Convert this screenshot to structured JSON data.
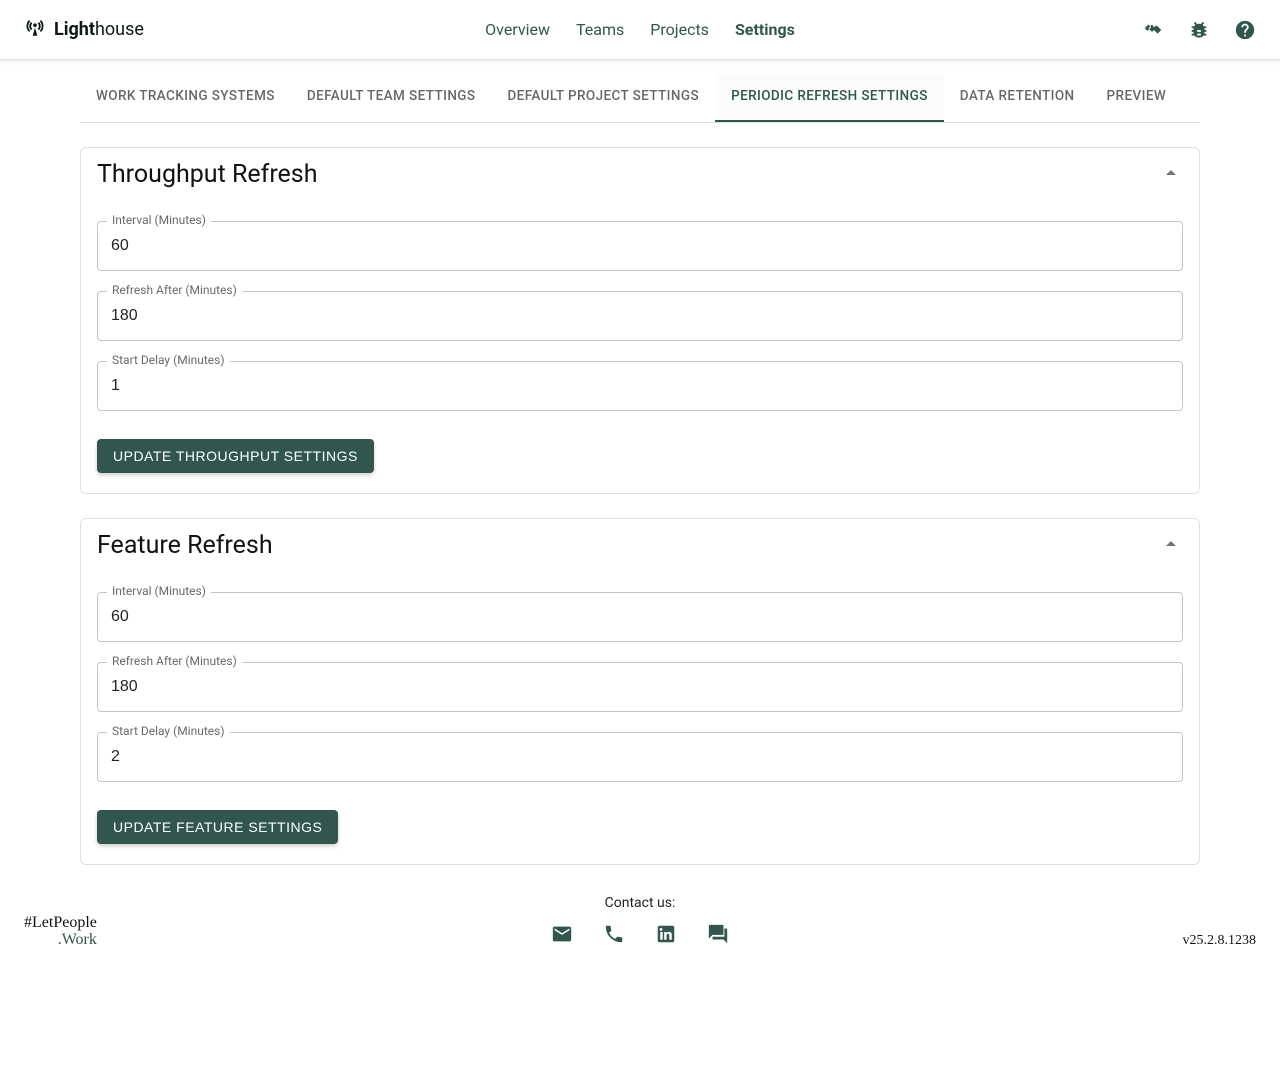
{
  "app": {
    "name_left": "Light",
    "name_right": "house"
  },
  "nav": {
    "items": [
      "Overview",
      "Teams",
      "Projects",
      "Settings"
    ],
    "active": "Settings"
  },
  "subtabs": {
    "items": [
      "Work Tracking Systems",
      "Default Team Settings",
      "Default Project Settings",
      "Periodic Refresh Settings",
      "Data Retention",
      "Preview"
    ],
    "active": "Periodic Refresh Settings"
  },
  "labels": {
    "interval": "Interval (Minutes)",
    "refresh_after": "Refresh After (Minutes)",
    "start_delay": "Start Delay (Minutes)"
  },
  "throughput": {
    "title": "Throughput Refresh",
    "interval": "60",
    "refresh_after": "180",
    "start_delay": "1",
    "button": "Update Throughput Settings"
  },
  "feature": {
    "title": "Feature Refresh",
    "interval": "60",
    "refresh_after": "180",
    "start_delay": "2",
    "button": "Update Feature Settings"
  },
  "footer": {
    "hashtag_top": "#LetPeople",
    "hashtag_bottom": ".Work",
    "contact_label": "Contact us:",
    "version": "v25.2.8.1238"
  }
}
